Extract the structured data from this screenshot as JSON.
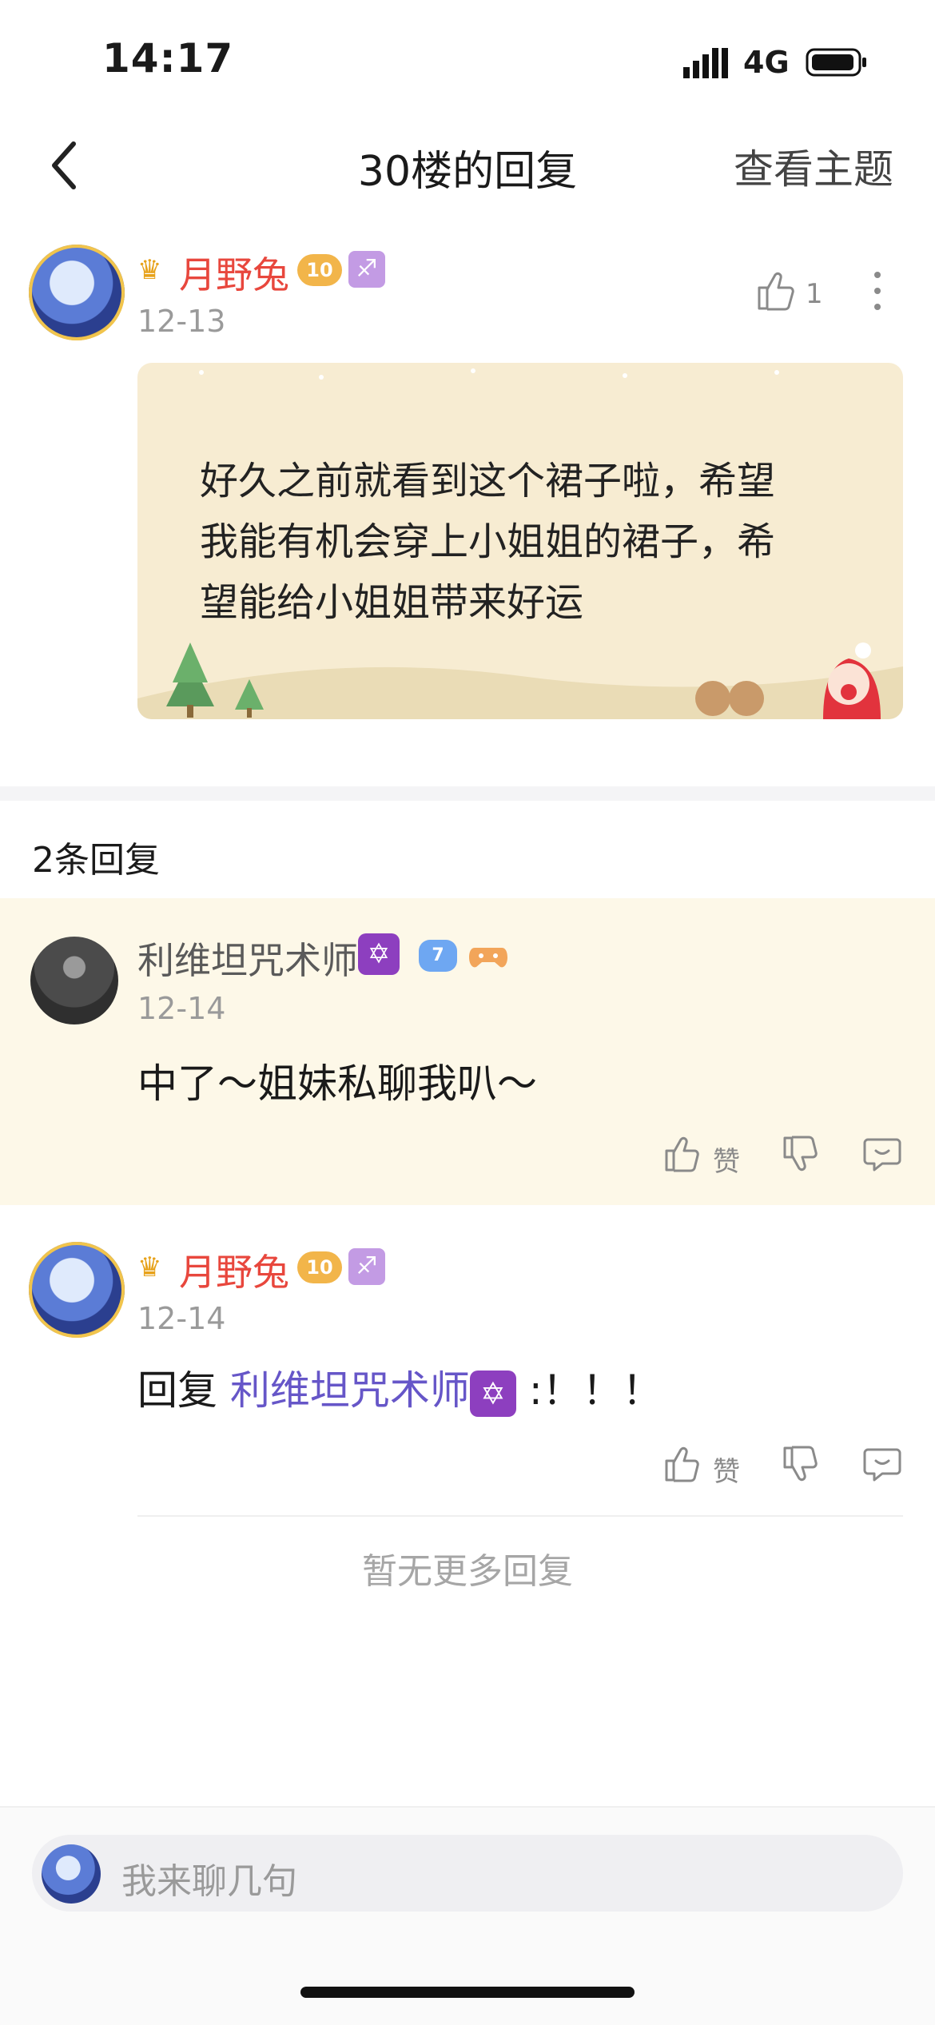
{
  "status_bar": {
    "time": "14:17",
    "network": "4G"
  },
  "nav": {
    "title": "30楼的回复",
    "action": "查看主题"
  },
  "main_post": {
    "author": "月野兔",
    "level": "10",
    "date": "12-13",
    "like_count": "1",
    "text_lines": [
      "好久之前就看到这个裙子啦，希望",
      "我能有机会穿上小姐姐的裙子，希",
      "望能给小姐姐带来好运"
    ]
  },
  "replies_header": "2条回复",
  "replies": [
    {
      "author": "利维坦咒术师",
      "level": "7",
      "date": "12-14",
      "text": "中了～姐妹私聊我叭～",
      "like_label": "赞"
    },
    {
      "author": "月野兔",
      "level": "10",
      "date": "12-14",
      "reply_prefix": "回复",
      "reply_to": "利维坦咒术师",
      "text": ":！！！",
      "like_label": "赞"
    }
  ],
  "no_more": "暂无更多回复",
  "input": {
    "placeholder": "我来聊几句"
  },
  "icons": {
    "back": "chevron-left-icon",
    "like": "thumbs-up-icon",
    "dislike": "thumbs-down-icon",
    "comment": "comment-icon",
    "more": "more-vertical-icon"
  },
  "colors": {
    "author_red": "#e8473d",
    "link_purple": "#6656c8",
    "card_bg": "#f7ecd2",
    "reply_highlight": "#fdf8e8"
  }
}
